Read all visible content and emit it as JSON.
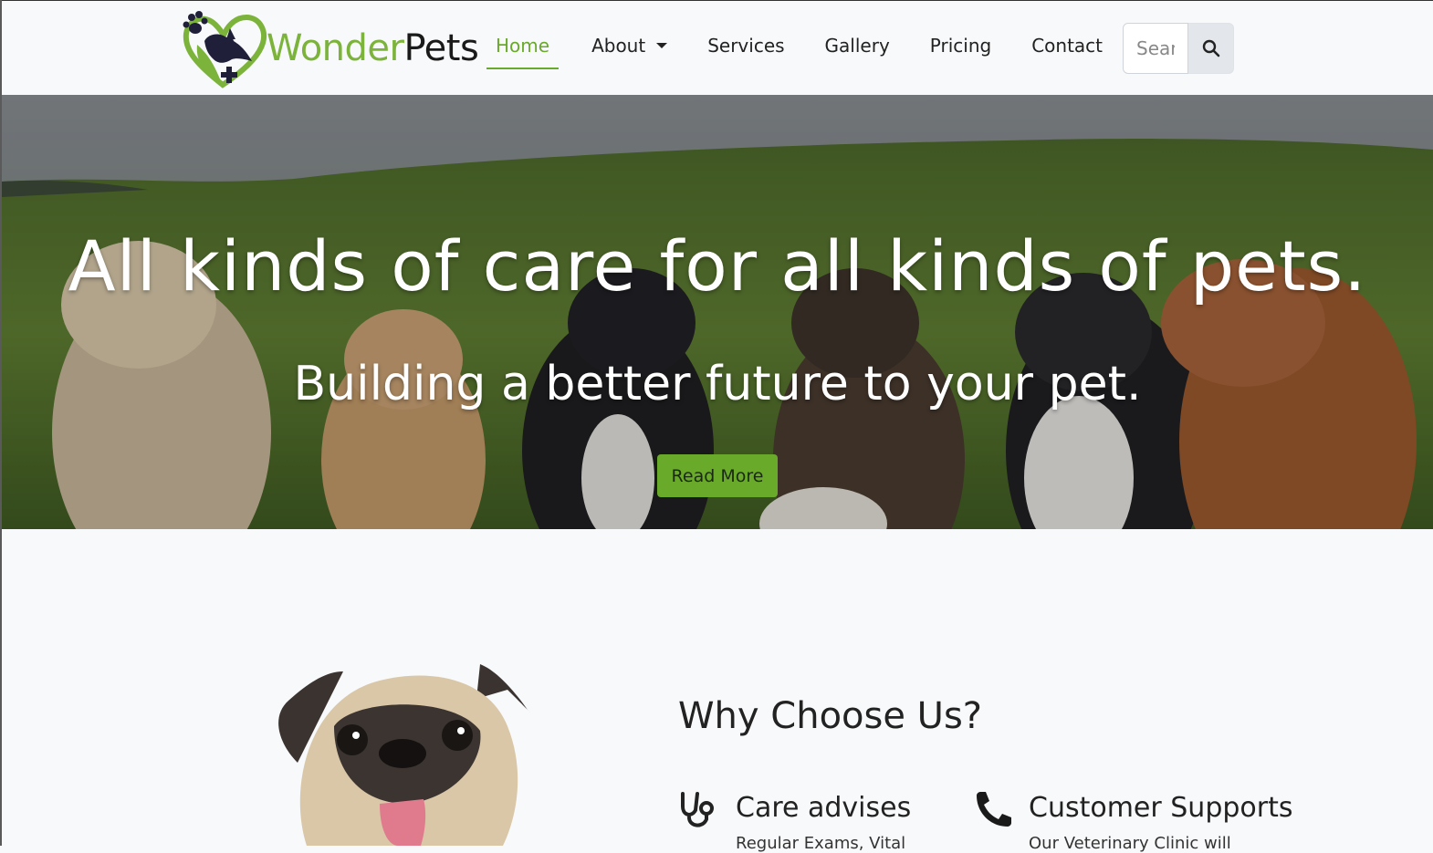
{
  "brand": {
    "name_part1": "Wonder",
    "name_part2": "Pets",
    "logo_icon": "paw-heart-logo-icon",
    "accent_color": "#7cb33a"
  },
  "nav": {
    "items": [
      {
        "label": "Home",
        "active": true
      },
      {
        "label": "About",
        "dropdown": true
      },
      {
        "label": "Services"
      },
      {
        "label": "Gallery"
      },
      {
        "label": "Pricing"
      },
      {
        "label": "Contact"
      }
    ]
  },
  "search": {
    "placeholder": "Search",
    "icon": "search-icon"
  },
  "hero": {
    "title": "All kinds of care for all kinds of pets.",
    "subtitle": "Building a better future to your pet.",
    "button_label": "Read More",
    "button_color": "#6aaa2a"
  },
  "why": {
    "heading": "Why Choose Us?",
    "features": [
      {
        "icon": "stethoscope-icon",
        "title": "Care advises",
        "text": "Regular Exams, Vital"
      },
      {
        "icon": "phone-icon",
        "title": "Customer Supports",
        "text": "Our Veterinary Clinic will"
      }
    ]
  }
}
